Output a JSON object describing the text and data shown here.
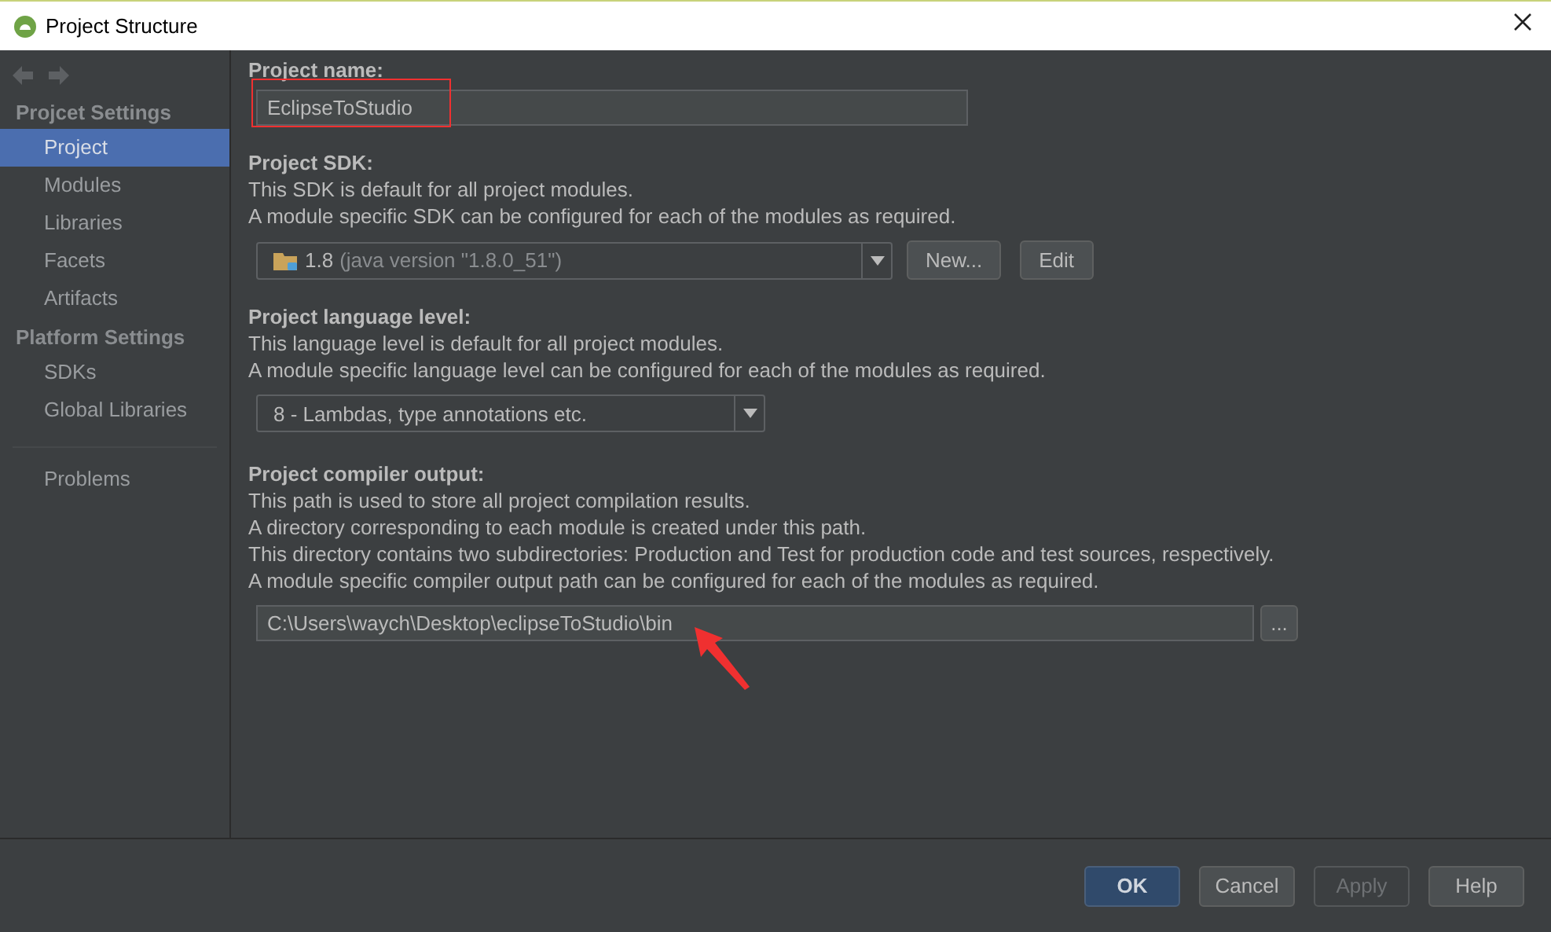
{
  "window": {
    "title": "Project Structure"
  },
  "sidebar": {
    "sections": [
      {
        "title": "Projcet Settings",
        "items": [
          {
            "label": "Project",
            "selected": true
          },
          {
            "label": "Modules",
            "selected": false
          },
          {
            "label": "Libraries",
            "selected": false
          },
          {
            "label": "Facets",
            "selected": false
          },
          {
            "label": "Artifacts",
            "selected": false
          }
        ]
      },
      {
        "title": "Platform Settings",
        "items": [
          {
            "label": "SDKs",
            "selected": false
          },
          {
            "label": "Global Libraries",
            "selected": false
          }
        ]
      }
    ],
    "bottom_items": [
      {
        "label": "Problems",
        "selected": false
      }
    ]
  },
  "project_name": {
    "label": "Project name:",
    "value": "EclipseToStudio"
  },
  "project_sdk": {
    "label": "Project SDK:",
    "lines": [
      "This SDK is default for all project modules.",
      "A module specific SDK can be configured for each of the modules as required."
    ],
    "version": "1.8",
    "detail": "(java version \"1.8.0_51\")",
    "buttons": [
      "New...",
      "Edit"
    ]
  },
  "language_level": {
    "label": "Project language level:",
    "lines": [
      "This language level is default for all project modules.",
      "A module specific language level can be configured for each of the modules as required."
    ],
    "value": "8 - Lambdas, type annotations etc."
  },
  "compiler_output": {
    "label": "Project compiler output:",
    "lines": [
      "This path is used to store all project compilation results.",
      "A directory corresponding to each module is created under this path.",
      "This directory contains two subdirectories: Production and Test for production code and test sources, respectively.",
      "A module specific compiler output path can be configured for each of the modules as required."
    ],
    "value": "C:\\Users\\waych\\Desktop\\eclipseToStudio\\bin",
    "browse": "..."
  },
  "buttons": [
    {
      "label": "OK",
      "kind": "default",
      "disabled": false
    },
    {
      "label": "Cancel",
      "kind": "normal",
      "disabled": false
    },
    {
      "label": "Apply",
      "kind": "normal",
      "disabled": true
    },
    {
      "label": "Help",
      "kind": "normal",
      "disabled": false
    }
  ]
}
